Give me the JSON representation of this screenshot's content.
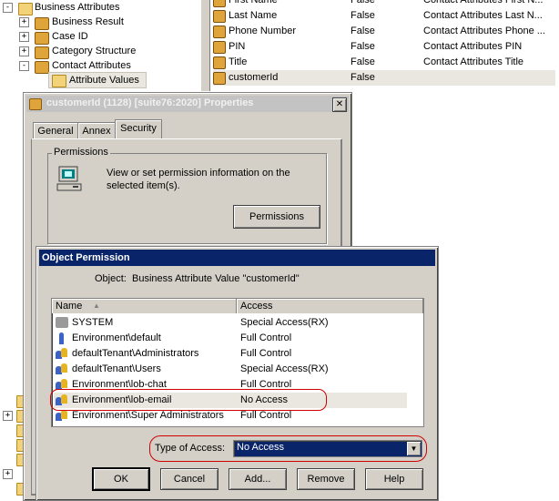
{
  "tree": {
    "items": [
      {
        "label": "Business Attributes",
        "expander": "-"
      },
      {
        "label": "Business Result",
        "expander": "+"
      },
      {
        "label": "Case ID",
        "expander": "+"
      },
      {
        "label": "Category Structure",
        "expander": "+"
      },
      {
        "label": "Contact Attributes",
        "expander": "-"
      },
      {
        "label": "Attribute Values",
        "expander": ""
      }
    ]
  },
  "attr_list": {
    "rows": [
      {
        "name": "First Name",
        "value": "False",
        "desc": "Contact Attributes First N..."
      },
      {
        "name": "Last Name",
        "value": "False",
        "desc": "Contact Attributes Last N..."
      },
      {
        "name": "Phone Number",
        "value": "False",
        "desc": "Contact Attributes Phone ..."
      },
      {
        "name": "PIN",
        "value": "False",
        "desc": "Contact Attributes PIN"
      },
      {
        "name": "Title",
        "value": "False",
        "desc": "Contact Attributes Title"
      },
      {
        "name": "customerId",
        "value": "False",
        "desc": ""
      }
    ]
  },
  "props": {
    "title": "customerId (1128) [suite76:2020] Properties",
    "close": "✕",
    "tabs": {
      "general": "General",
      "annex": "Annex",
      "security": "Security"
    },
    "group_label": "Permissions",
    "desc": "View or set permission information on the selected item(s).",
    "permissions_btn": "Permissions"
  },
  "objperm": {
    "title": "Object Permission",
    "object_label": "Object:",
    "object_value": "Business Attribute Value \"customerId\"",
    "col_name": "Name",
    "col_access": "Access",
    "rows": [
      {
        "name": "SYSTEM",
        "access": "Special Access(RX)"
      },
      {
        "name": "Environment\\default",
        "access": "Full Control"
      },
      {
        "name": "defaultTenant\\Administrators",
        "access": "Full Control"
      },
      {
        "name": "defaultTenant\\Users",
        "access": "Special Access(RX)"
      },
      {
        "name": "Environment\\lob-chat",
        "access": "Full Control"
      },
      {
        "name": "Environment\\lob-email",
        "access": "No Access"
      },
      {
        "name": "Environment\\Super Administrators",
        "access": "Full Control"
      }
    ],
    "type_label": "Type of Access:",
    "type_value": "No Access",
    "buttons": {
      "ok": "OK",
      "cancel": "Cancel",
      "add": "Add...",
      "remove": "Remove",
      "help": "Help"
    }
  },
  "colors": {
    "accent": "#0a246a",
    "highlight_ring": "#d00000",
    "face": "#d4d0c8"
  }
}
